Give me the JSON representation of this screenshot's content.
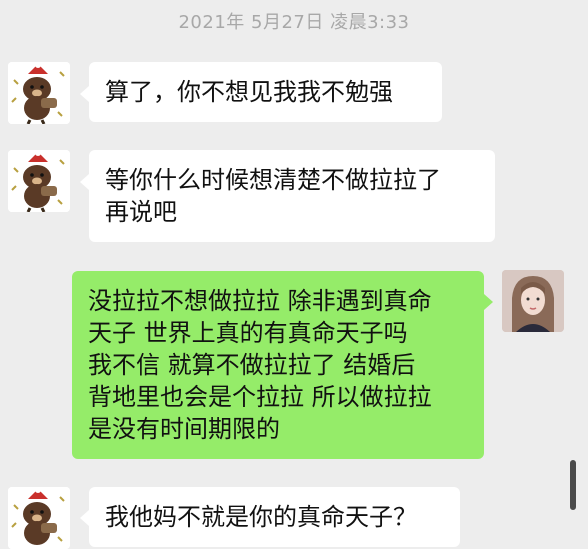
{
  "chat": {
    "timestamp": "2021年 5月27日 凌晨3:33",
    "messages": [
      {
        "side": "left",
        "avatar": "bear-avatar",
        "text": "算了，你不想见我我不勉强"
      },
      {
        "side": "left",
        "avatar": "bear-avatar",
        "text": "等你什么时候想清楚不做拉拉了\n再说吧"
      },
      {
        "side": "right",
        "avatar": "girl-avatar",
        "text": "没拉拉不想做拉拉 除非遇到真命\n天子 世界上真的有真命天子吗\n我不信 就算不做拉拉了 结婚后\n背地里也会是个拉拉 所以做拉拉\n是没有时间期限的"
      },
      {
        "side": "left",
        "avatar": "bear-avatar",
        "text": "我他妈不就是你的真命天子？"
      }
    ]
  },
  "colors": {
    "background": "#ededed",
    "left_bubble": "#ffffff",
    "right_bubble": "#95ec69",
    "timestamp_text": "#a8a8a8"
  }
}
